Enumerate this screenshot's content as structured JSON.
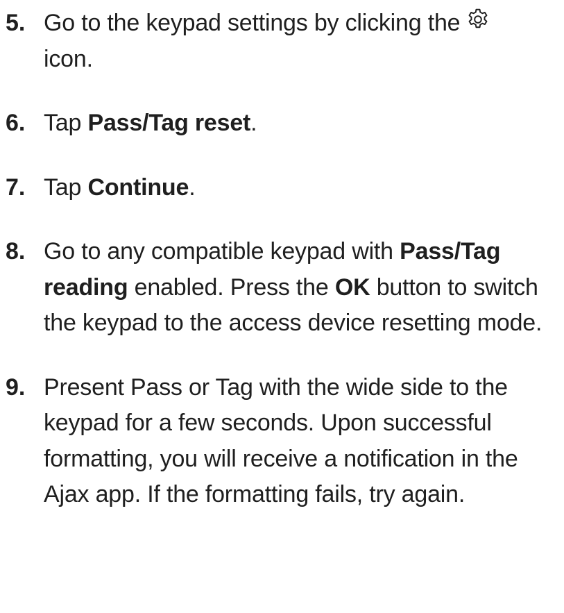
{
  "steps": [
    {
      "number": "5.",
      "before_icon": "Go to the keypad settings by clicking the",
      "icon": "gear-icon",
      "after_icon": "icon."
    },
    {
      "number": "6.",
      "prefix": "Tap",
      "bold": "Pass/Tag reset",
      "suffix": "."
    },
    {
      "number": "7.",
      "prefix": "Tap",
      "bold": "Continue",
      "suffix": "."
    },
    {
      "number": "8.",
      "part1": "Go to any compatible keypad with",
      "bold1": "Pass/Tag reading",
      "part2": "enabled. Press the",
      "bold2": "OK",
      "part3": "button to switch the keypad to the access device resetting mode."
    },
    {
      "number": "9.",
      "text": "Present Pass or Tag with the wide side to the keypad for a few seconds. Upon successful formatting, you will receive a notification in the Ajax app. If the formatting fails, try again."
    }
  ]
}
